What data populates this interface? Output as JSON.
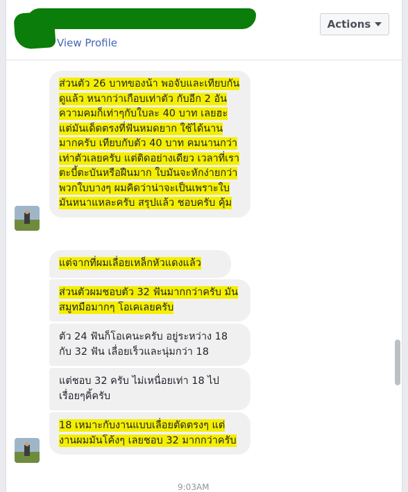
{
  "header": {
    "view_profile": "View Profile",
    "actions_label": "Actions"
  },
  "messages": [
    "ส่วนตัว 26 บาทของน้า พอจับและเทียบกันดูแล้ว หนากว่าเกือบเท่าตัว กับอีก 2 อัน ความคมก็เท่าๆกับใบละ 40 บาท เลยฮะ แต่มันเด็ดตรงที่ฟันหมดยาก ใช้ได้นานมากครับ เทียบกับตัว 40 บาท คมนานกว่าเท่าตัวเลยครับ แต่ติดอย่างเดียว เวลาที่เราตะบี้ตะบันหรือฝืนมาก ใบมันจะหักง่ายกว่าพวกใบบางๆ ผมคิดว่าน่าจะเป็นเพราะใบมันหนาแหละครับ สรุปแล้ว ชอบครับ คุ้ม",
    "แต่จากที่ผมเลื่อยเหล็กหัวแดงแล้ว",
    "ส่วนตัวผมชอบตัว 32 ฟันมากกว่าครับ มันสมูทมือมากๆ โอเคเลยครับ",
    "ตัว 24 ฟันก็โอเคนะครับ อยู่ระหว่าง 18 กับ 32 ฟัน เลื่อยเร็วและนุ่มกว่า 18",
    "แต่ชอบ 32 ครับ ไม่เหนื่อยเท่า 18 ไปเรื่อยๆคิ้ครับ",
    "18 เหมาะกับงานแบบเลื่อยตัดตรงๆ แต่งานผมมันโค้งๆ เลยชอบ 32 มากกว่าครับ"
  ],
  "timestamp": "9:03AM",
  "colors": {
    "highlight": "#f4ef00",
    "bubble": "#f1f0f0",
    "link": "#4267b2"
  }
}
